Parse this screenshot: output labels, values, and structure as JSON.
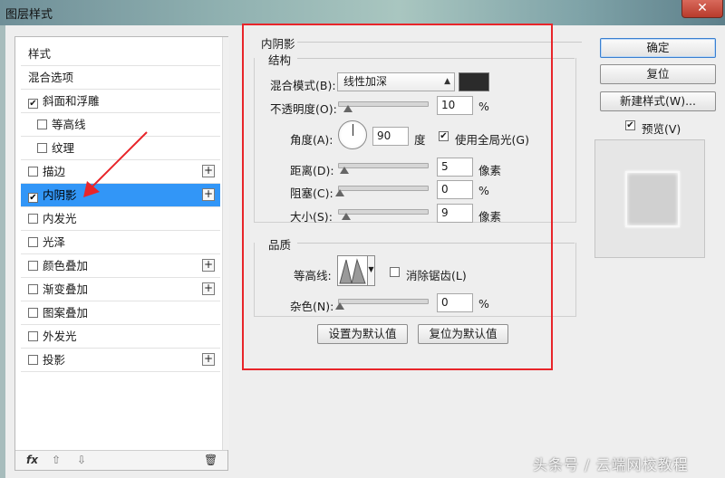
{
  "window": {
    "title": "图层样式",
    "close_glyph": "✕"
  },
  "styles_list": {
    "items": [
      {
        "label": "样式",
        "checkbox": false,
        "checked": false,
        "plus": false,
        "sub": false,
        "selected": false
      },
      {
        "label": "混合选项",
        "checkbox": false,
        "checked": false,
        "plus": false,
        "sub": false,
        "selected": false
      },
      {
        "label": "斜面和浮雕",
        "checkbox": true,
        "checked": true,
        "plus": false,
        "sub": false,
        "selected": false
      },
      {
        "label": "等高线",
        "checkbox": true,
        "checked": false,
        "plus": false,
        "sub": true,
        "selected": false
      },
      {
        "label": "纹理",
        "checkbox": true,
        "checked": false,
        "plus": false,
        "sub": true,
        "selected": false
      },
      {
        "label": "描边",
        "checkbox": true,
        "checked": false,
        "plus": true,
        "sub": false,
        "selected": false
      },
      {
        "label": "内阴影",
        "checkbox": true,
        "checked": true,
        "plus": true,
        "sub": false,
        "selected": true
      },
      {
        "label": "内发光",
        "checkbox": true,
        "checked": false,
        "plus": false,
        "sub": false,
        "selected": false
      },
      {
        "label": "光泽",
        "checkbox": true,
        "checked": false,
        "plus": false,
        "sub": false,
        "selected": false
      },
      {
        "label": "颜色叠加",
        "checkbox": true,
        "checked": false,
        "plus": true,
        "sub": false,
        "selected": false
      },
      {
        "label": "渐变叠加",
        "checkbox": true,
        "checked": false,
        "plus": true,
        "sub": false,
        "selected": false
      },
      {
        "label": "图案叠加",
        "checkbox": true,
        "checked": false,
        "plus": false,
        "sub": false,
        "selected": false
      },
      {
        "label": "外发光",
        "checkbox": true,
        "checked": false,
        "plus": false,
        "sub": false,
        "selected": false
      },
      {
        "label": "投影",
        "checkbox": true,
        "checked": false,
        "plus": true,
        "sub": false,
        "selected": false
      }
    ],
    "footer": {
      "fx": "fx",
      "up": "⇧",
      "down": "⇩",
      "trash": "🗑"
    }
  },
  "panel": {
    "section_title": "内阴影",
    "structure": {
      "group_title": "结构",
      "blend_mode_label": "混合模式(B):",
      "blend_mode_value": "线性加深",
      "blend_color": "#2b2b2b",
      "opacity_label": "不透明度(O):",
      "opacity_value": "10",
      "opacity_unit": "%",
      "angle_label": "角度(A):",
      "angle_value": "90",
      "angle_unit": "度",
      "global_light_label": "使用全局光(G)",
      "global_light_checked": true,
      "distance_label": "距离(D):",
      "distance_value": "5",
      "distance_unit": "像素",
      "choke_label": "阻塞(C):",
      "choke_value": "0",
      "choke_unit": "%",
      "size_label": "大小(S):",
      "size_value": "9",
      "size_unit": "像素"
    },
    "quality": {
      "group_title": "品质",
      "contour_label": "等高线:",
      "antialias_label": "消除锯齿(L)",
      "antialias_checked": false,
      "noise_label": "杂色(N):",
      "noise_value": "0",
      "noise_unit": "%"
    },
    "buttons": {
      "make_default": "设置为默认值",
      "reset_default": "复位为默认值"
    }
  },
  "right": {
    "ok": "确定",
    "reset": "复位",
    "new_style": "新建样式(W)...",
    "preview_label": "预览(V)",
    "preview_checked": true
  },
  "annotation": {
    "highlight_color": "#e8252a",
    "arrow_color": "#e8252a"
  },
  "watermark": "头条号 / 云端网校教程"
}
